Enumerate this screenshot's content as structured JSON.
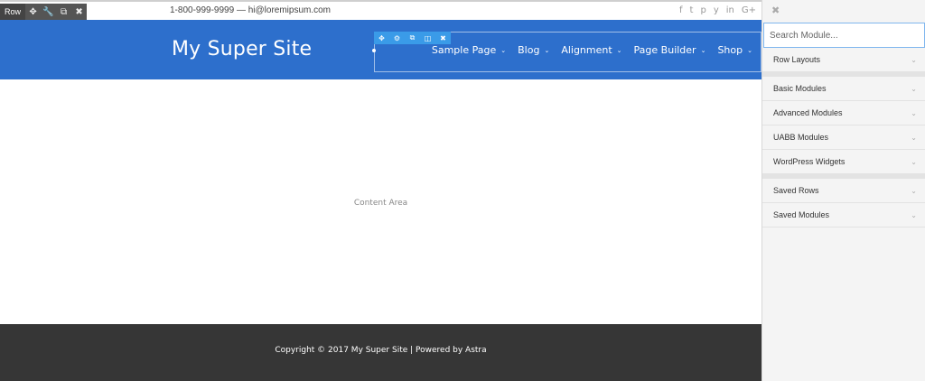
{
  "row_toolbar": {
    "label": "Row",
    "buttons": [
      {
        "icon": "move-icon",
        "glyph": "✥"
      },
      {
        "icon": "wrench-icon",
        "glyph": "🔧"
      },
      {
        "icon": "duplicate-icon",
        "glyph": "⧉"
      },
      {
        "icon": "close-icon",
        "glyph": "✖"
      }
    ]
  },
  "topbar": {
    "contact": "1-800-999-9999 — hi@loremipsum.com",
    "social": [
      {
        "icon": "facebook-icon",
        "glyph": "f"
      },
      {
        "icon": "twitter-icon",
        "glyph": "t"
      },
      {
        "icon": "pinterest-icon",
        "glyph": "p"
      },
      {
        "icon": "yelp-icon",
        "glyph": "y"
      },
      {
        "icon": "linkedin-icon",
        "glyph": "in"
      },
      {
        "icon": "google-plus-icon",
        "glyph": "G+"
      }
    ]
  },
  "header": {
    "site_title": "My Super Site",
    "bg_color": "#2d6fcc"
  },
  "module_toolbar": {
    "buttons": [
      {
        "icon": "move-icon",
        "glyph": "✥"
      },
      {
        "icon": "wrench-icon",
        "glyph": "⚙"
      },
      {
        "icon": "duplicate-icon",
        "glyph": "⧉"
      },
      {
        "icon": "columns-icon",
        "glyph": "◫"
      },
      {
        "icon": "close-icon",
        "glyph": "✖"
      }
    ]
  },
  "nav": {
    "items": [
      {
        "label": "Sample Page",
        "chevron": "⌄"
      },
      {
        "label": "Blog",
        "chevron": "⌄"
      },
      {
        "label": "Alignment",
        "chevron": "⌄"
      },
      {
        "label": "Page Builder",
        "chevron": "⌄"
      },
      {
        "label": "Shop",
        "chevron": "⌄"
      }
    ]
  },
  "content": {
    "label": "Content Area"
  },
  "footer": {
    "text": "Copyright © 2017 My Super Site | Powered by Astra",
    "bg_color": "#363636"
  },
  "panel": {
    "close_glyph": "✖",
    "search_placeholder": "Search Module...",
    "groups": [
      {
        "sections": [
          {
            "label": "Row Layouts"
          }
        ]
      },
      {
        "sections": [
          {
            "label": "Basic Modules"
          },
          {
            "label": "Advanced Modules"
          },
          {
            "label": "UABB Modules"
          },
          {
            "label": "WordPress Widgets"
          }
        ]
      },
      {
        "sections": [
          {
            "label": "Saved Rows"
          },
          {
            "label": "Saved Modules"
          }
        ]
      }
    ],
    "chevron_glyph": "⌄"
  }
}
